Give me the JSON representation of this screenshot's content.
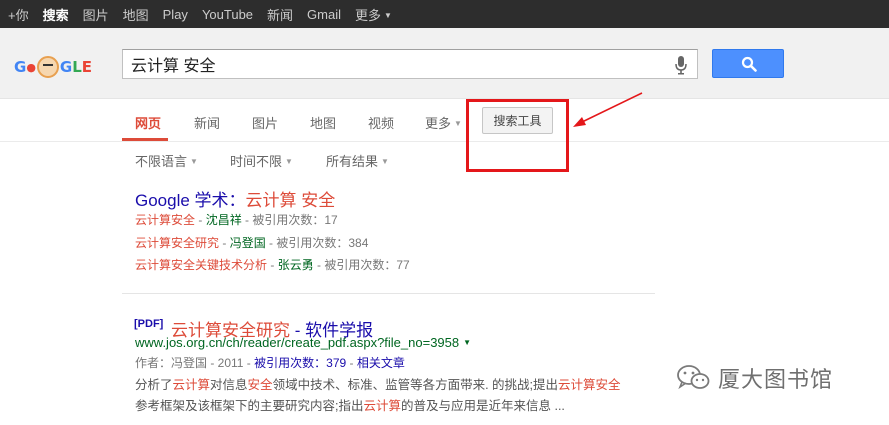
{
  "topbar": {
    "items": [
      {
        "label": "+你"
      },
      {
        "label": "搜索"
      },
      {
        "label": "图片"
      },
      {
        "label": "地图"
      },
      {
        "label": "Play"
      },
      {
        "label": "YouTube"
      },
      {
        "label": "新闻"
      },
      {
        "label": "Gmail"
      },
      {
        "label": "更多"
      }
    ]
  },
  "header": {
    "logo_icon": "google-doodle-logo",
    "search_value": "云计算 安全",
    "mic_icon": "microphone-icon",
    "search_icon": "magnifier-icon",
    "search_button_color": "#4d90fe"
  },
  "tabs": {
    "items": [
      {
        "label": "网页"
      },
      {
        "label": "新闻"
      },
      {
        "label": "图片"
      },
      {
        "label": "地图"
      },
      {
        "label": "视频"
      },
      {
        "label": "更多"
      }
    ],
    "active_index": 0,
    "tools_label": "搜索工具",
    "active_color": "#dd4b39"
  },
  "filters": [
    {
      "label": "不限语言"
    },
    {
      "label": "时间不限"
    },
    {
      "label": "所有结果"
    }
  ],
  "annotation": {
    "box_color": "#e4171a"
  },
  "results": {
    "scholar": {
      "title_prefix": "Google 学术：",
      "title_query": "云计算 安全",
      "items": [
        {
          "title": "云计算安全",
          "sep": " - ",
          "author": "沈昌祥",
          "cited": " - 被引用次数：17"
        },
        {
          "title": "云计算安全研究",
          "sep": " - ",
          "author": "冯登国",
          "cited": " - 被引用次数：384"
        },
        {
          "title": "云计算安全关键技术分析",
          "sep": " - ",
          "author": "张云勇",
          "cited": " - 被引用次数：77"
        }
      ]
    },
    "result1": {
      "tag": "[PDF]",
      "title_hl": "云计算安全研究",
      "title_rest": " - 软件学报",
      "url": "www.jos.org.cn/ch/reader/create_pdf.aspx?file_no=3958",
      "meta_prefix": "作者：冯登国 - 2011 - ",
      "cited_link": "被引用次数：379",
      "meta_sep": " - ",
      "related_link": "相关文章",
      "snippet1": [
        {
          "text": "分析了",
          "em": false
        },
        {
          "text": "云计算",
          "em": true
        },
        {
          "text": "对信息",
          "em": false
        },
        {
          "text": "安全",
          "em": true
        },
        {
          "text": "领域中技术、标准、监管等各方面带来. 的挑战;提出",
          "em": false
        },
        {
          "text": "云计算安全",
          "em": true
        }
      ],
      "snippet2": [
        {
          "text": "参考框架及该框架下的主要研究内容;指出",
          "em": false
        },
        {
          "text": "云计算",
          "em": true
        },
        {
          "text": "的普及与应用是近年来信息 ...",
          "em": false
        }
      ]
    }
  },
  "watermark": {
    "icon": "wechat-icon",
    "text": "厦大图书馆"
  }
}
